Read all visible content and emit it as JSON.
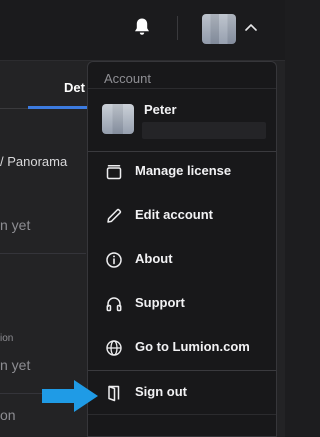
{
  "background": {
    "tab_label": "Det",
    "project_title_fragment": "/ Panorama",
    "status_fragment_1": "n yet",
    "small_label_fragment": "ion",
    "status_fragment_2": "n yet",
    "bottom_fragment": "on"
  },
  "menu": {
    "heading": "Account",
    "user": {
      "name": "Peter"
    },
    "items": [
      {
        "label": "Manage license",
        "icon": "license-icon"
      },
      {
        "label": "Edit account",
        "icon": "pencil-icon"
      },
      {
        "label": "About",
        "icon": "info-icon"
      },
      {
        "label": "Support",
        "icon": "headphones-icon"
      },
      {
        "label": "Go to Lumion.com",
        "icon": "globe-icon"
      },
      {
        "label": "Sign out",
        "icon": "sign-out-icon"
      }
    ]
  },
  "colors": {
    "accent": "#3c7be0",
    "annotation_arrow": "#1f9be6",
    "menu_bg": "#18181a"
  }
}
